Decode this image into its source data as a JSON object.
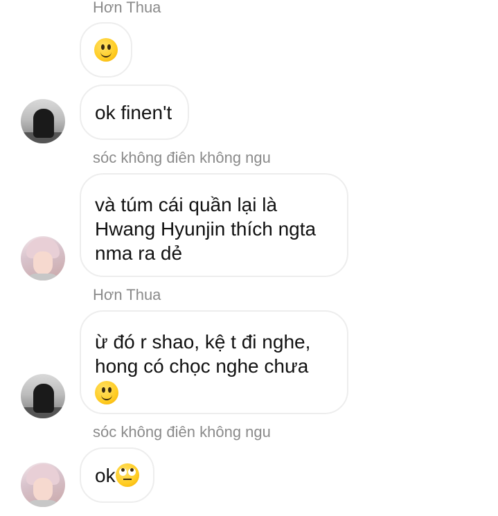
{
  "messages": [
    {
      "sender": "Hơn Thua",
      "text": "",
      "emoji": "slightly-smiling-face"
    },
    {
      "sender": "",
      "text": "ok finen't",
      "emoji": ""
    },
    {
      "sender": "sóc không điên không ngu",
      "text": "và túm cái quần lại là\nHwang Hyunjin thích ngta\nnma ra dẻ",
      "emoji": ""
    },
    {
      "sender": "Hơn Thua",
      "text": "ừ đó r shao, kệ t đi nghe,\nhong có chọc nghe chưa",
      "emoji": "slightly-smiling-face"
    },
    {
      "sender": "sóc không điên không ngu",
      "text": "ok",
      "emoji": "face-with-rolling-eyes"
    }
  ],
  "colors": {
    "background": "#ffffff",
    "bubble_border": "#ededed",
    "sender_name": "#8a8a8a",
    "message_text": "#111111"
  }
}
